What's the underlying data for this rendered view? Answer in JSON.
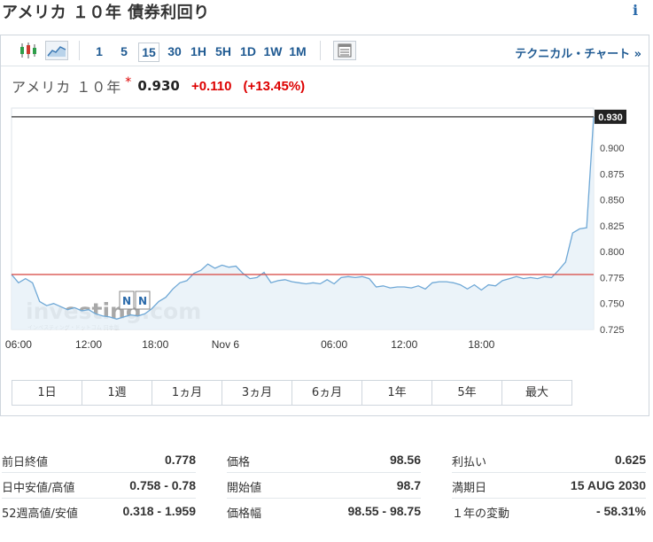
{
  "page": {
    "title": "アメリカ １０年 債券利回り",
    "info_icon": "info-icon"
  },
  "toolbar": {
    "chart_type_icons": [
      "candlestick-icon",
      "area-chart-icon"
    ],
    "intervals": [
      "1",
      "5",
      "15",
      "30",
      "1H",
      "5H",
      "1D",
      "1W",
      "1M"
    ],
    "active_interval": "15",
    "table_icon": "table-icon",
    "technical_link": "テクニカル・チャート »"
  },
  "quote": {
    "name": "アメリカ １０年",
    "star": "*",
    "price": "0.930",
    "change": "+0.110",
    "change_pct": "(+13.45%)"
  },
  "colors": {
    "accent": "#1f5a92",
    "negative": "#dd0000",
    "line": "#6fa8d6",
    "area": "#e8f1f8",
    "prev_close_line": "#d9534f",
    "last_price_line": "#555555",
    "last_price_box": "#222222"
  },
  "chart_data": {
    "type": "area",
    "x": [
      0,
      1,
      2,
      3,
      4,
      5,
      6,
      7,
      8,
      9,
      10,
      11,
      12,
      13,
      14,
      15,
      16,
      17,
      18,
      19,
      20,
      21,
      22,
      23,
      24,
      25,
      26,
      27,
      28,
      29,
      30,
      31,
      32,
      33,
      34,
      35,
      36,
      37,
      38,
      39,
      40,
      41,
      42,
      43,
      44,
      45,
      46,
      47,
      48,
      49,
      50,
      51,
      52,
      53,
      54,
      55,
      56,
      57,
      58,
      59,
      60,
      61,
      62,
      63,
      64,
      65,
      66,
      67,
      68,
      69,
      70,
      71,
      72,
      73,
      74,
      75,
      76,
      77,
      78,
      79,
      80,
      81,
      82,
      83
    ],
    "values": [
      0.778,
      0.77,
      0.774,
      0.77,
      0.752,
      0.748,
      0.75,
      0.747,
      0.744,
      0.746,
      0.743,
      0.744,
      0.74,
      0.738,
      0.737,
      0.735,
      0.737,
      0.739,
      0.738,
      0.74,
      0.745,
      0.752,
      0.756,
      0.764,
      0.77,
      0.772,
      0.779,
      0.782,
      0.788,
      0.784,
      0.787,
      0.785,
      0.786,
      0.779,
      0.774,
      0.775,
      0.78,
      0.77,
      0.772,
      0.773,
      0.771,
      0.77,
      0.769,
      0.77,
      0.769,
      0.773,
      0.769,
      0.775,
      0.776,
      0.775,
      0.776,
      0.774,
      0.766,
      0.767,
      0.765,
      0.766,
      0.766,
      0.765,
      0.767,
      0.764,
      0.77,
      0.771,
      0.771,
      0.77,
      0.768,
      0.764,
      0.768,
      0.763,
      0.768,
      0.767,
      0.772,
      0.774,
      0.776,
      0.774,
      0.775,
      0.774,
      0.776,
      0.775,
      0.782,
      0.79,
      0.818,
      0.822,
      0.823,
      0.93
    ],
    "x_ticks": [
      {
        "x": 1,
        "label": "06:00"
      },
      {
        "x": 11,
        "label": "12:00"
      },
      {
        "x": 20.5,
        "label": "18:00"
      },
      {
        "x": 30.5,
        "label": "Nov 6"
      },
      {
        "x": 46,
        "label": "06:00"
      },
      {
        "x": 56,
        "label": "12:00"
      },
      {
        "x": 67,
        "label": "18:00"
      }
    ],
    "y_ticks": [
      0.725,
      0.75,
      0.775,
      0.8,
      0.825,
      0.85,
      0.875,
      0.9
    ],
    "y_tick_labels": [
      "0.725",
      "0.750",
      "0.775",
      "0.800",
      "0.825",
      "0.850",
      "0.875",
      "0.900"
    ],
    "ylim": [
      0.725,
      0.935
    ],
    "xlim": [
      0,
      83
    ],
    "prev_close": 0.778,
    "last_price": 0.93,
    "last_price_label": "0.930",
    "grid": false,
    "watermark": "investing.com",
    "watermark_sub": "インベスティング・ドットコム 日本版"
  },
  "ranges": [
    "1日",
    "1週",
    "1ヵ月",
    "3ヵ月",
    "6ヵ月",
    "1年",
    "5年",
    "最大"
  ],
  "stats": {
    "col1": [
      {
        "label": "前日終値",
        "value": "0.778"
      },
      {
        "label": "日中安値/高値",
        "value": "0.758 - 0.78"
      },
      {
        "label": "52週高値/安値",
        "value": "0.318 - 1.959"
      }
    ],
    "col2": [
      {
        "label": "価格",
        "value": "98.56"
      },
      {
        "label": "開始値",
        "value": "98.7"
      },
      {
        "label": "価格幅",
        "value": "98.55 - 98.75"
      }
    ],
    "col3": [
      {
        "label": "利払い",
        "value": "0.625"
      },
      {
        "label": "満期日",
        "value": "15 AUG 2030"
      },
      {
        "label": "１年の変動",
        "value": "- 58.31%"
      }
    ]
  }
}
